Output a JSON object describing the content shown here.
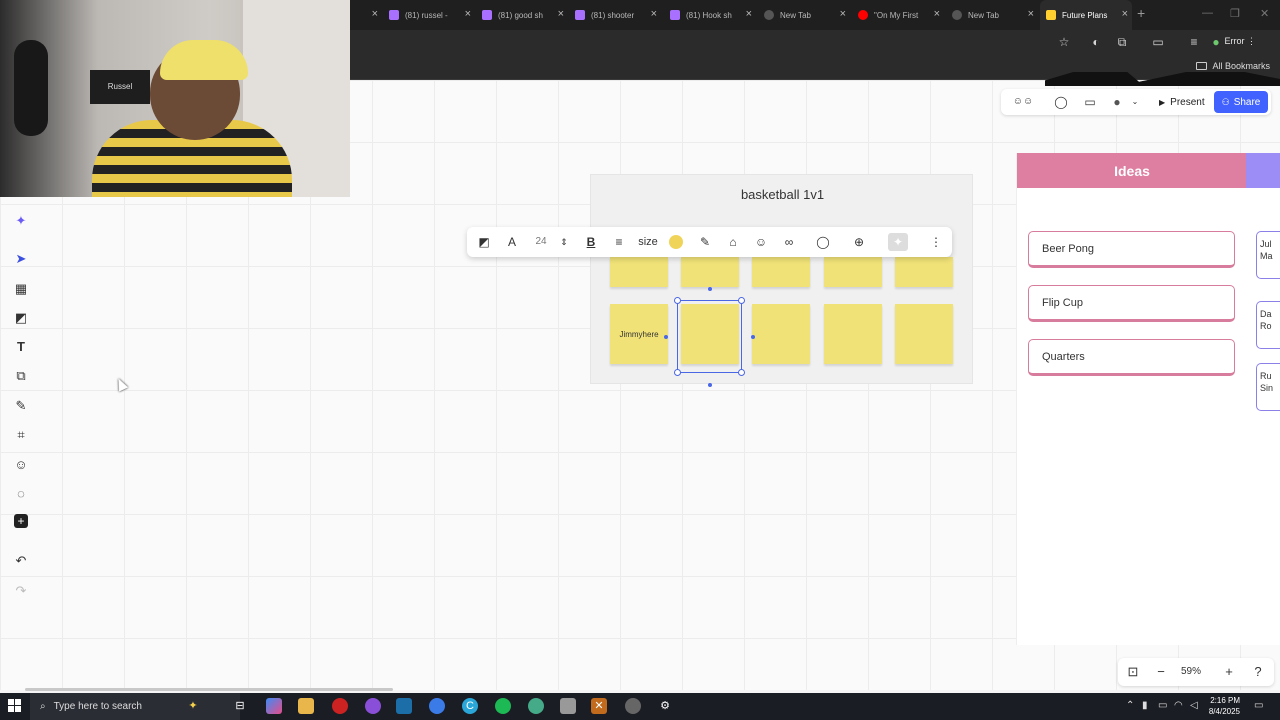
{
  "browser": {
    "tabs": [
      {
        "label": "(81) russel -",
        "color": "#a970ff"
      },
      {
        "label": "(81) good sh",
        "color": "#a970ff"
      },
      {
        "label": "(81) shooter",
        "color": "#a970ff"
      },
      {
        "label": "(81) Hook sh",
        "color": "#a970ff"
      },
      {
        "label": "New Tab",
        "color": "#cccccc"
      },
      {
        "label": "\"On My First",
        "color": "#ff0000"
      },
      {
        "label": "New Tab",
        "color": "#cccccc"
      },
      {
        "label": "Future Plans",
        "color": "#ffd02f"
      }
    ],
    "profile_status": "Error",
    "all_bookmarks": "All Bookmarks"
  },
  "webcam": {
    "sign_text": "Russel"
  },
  "board": {
    "topbar": {
      "present_label": "Present",
      "share_label": "Share"
    },
    "frame": {
      "title": "basketball 1v1",
      "row1": [
        "",
        "",
        "",
        "",
        ""
      ],
      "row2": [
        "Jimmyhere",
        "",
        "",
        "",
        ""
      ]
    },
    "float_toolbar": {
      "font_size": "24",
      "size_label": "size",
      "sticky_color": "#f0d45a"
    },
    "ideas": {
      "title": "Ideas",
      "header_color": "#de7ea0",
      "items": [
        "Beer Pong",
        "Flip Cup",
        "Quarters"
      ]
    },
    "panel2": {
      "header_color": "#9b8cf6",
      "items": [
        "Jul\nMa",
        "Da\nRo",
        "Ru\nSin"
      ]
    },
    "zoom": {
      "level": "59%"
    }
  },
  "taskbar": {
    "search_placeholder": "Type here to search",
    "time": "2:16 PM",
    "date": "8/4/2025"
  }
}
